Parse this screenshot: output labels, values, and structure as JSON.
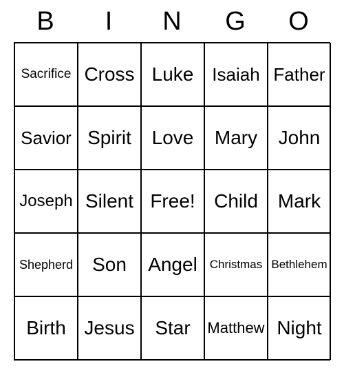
{
  "header": {
    "letters": [
      "B",
      "I",
      "N",
      "G",
      "O"
    ]
  },
  "grid": {
    "rows": [
      [
        {
          "text": "Sacrifice",
          "size": "fs-19"
        },
        {
          "text": "Cross",
          "size": "fs-28"
        },
        {
          "text": "Luke",
          "size": "fs-28"
        },
        {
          "text": "Isaiah",
          "size": "fs-26"
        },
        {
          "text": "Father",
          "size": "fs-26"
        }
      ],
      [
        {
          "text": "Savior",
          "size": "fs-26"
        },
        {
          "text": "Spirit",
          "size": "fs-28"
        },
        {
          "text": "Love",
          "size": "fs-28"
        },
        {
          "text": "Mary",
          "size": "fs-28"
        },
        {
          "text": "John",
          "size": "fs-28"
        }
      ],
      [
        {
          "text": "Joseph",
          "size": "fs-24"
        },
        {
          "text": "Silent",
          "size": "fs-28"
        },
        {
          "text": "Free!",
          "size": "fs-28"
        },
        {
          "text": "Child",
          "size": "fs-28"
        },
        {
          "text": "Mark",
          "size": "fs-28"
        }
      ],
      [
        {
          "text": "Shepherd",
          "size": "fs-18"
        },
        {
          "text": "Son",
          "size": "fs-28"
        },
        {
          "text": "Angel",
          "size": "fs-28"
        },
        {
          "text": "Christmas",
          "size": "fs-17"
        },
        {
          "text": "Bethlehem",
          "size": "fs-17"
        }
      ],
      [
        {
          "text": "Birth",
          "size": "fs-28"
        },
        {
          "text": "Jesus",
          "size": "fs-28"
        },
        {
          "text": "Star",
          "size": "fs-28"
        },
        {
          "text": "Matthew",
          "size": "fs-22"
        },
        {
          "text": "Night",
          "size": "fs-28"
        }
      ]
    ]
  }
}
